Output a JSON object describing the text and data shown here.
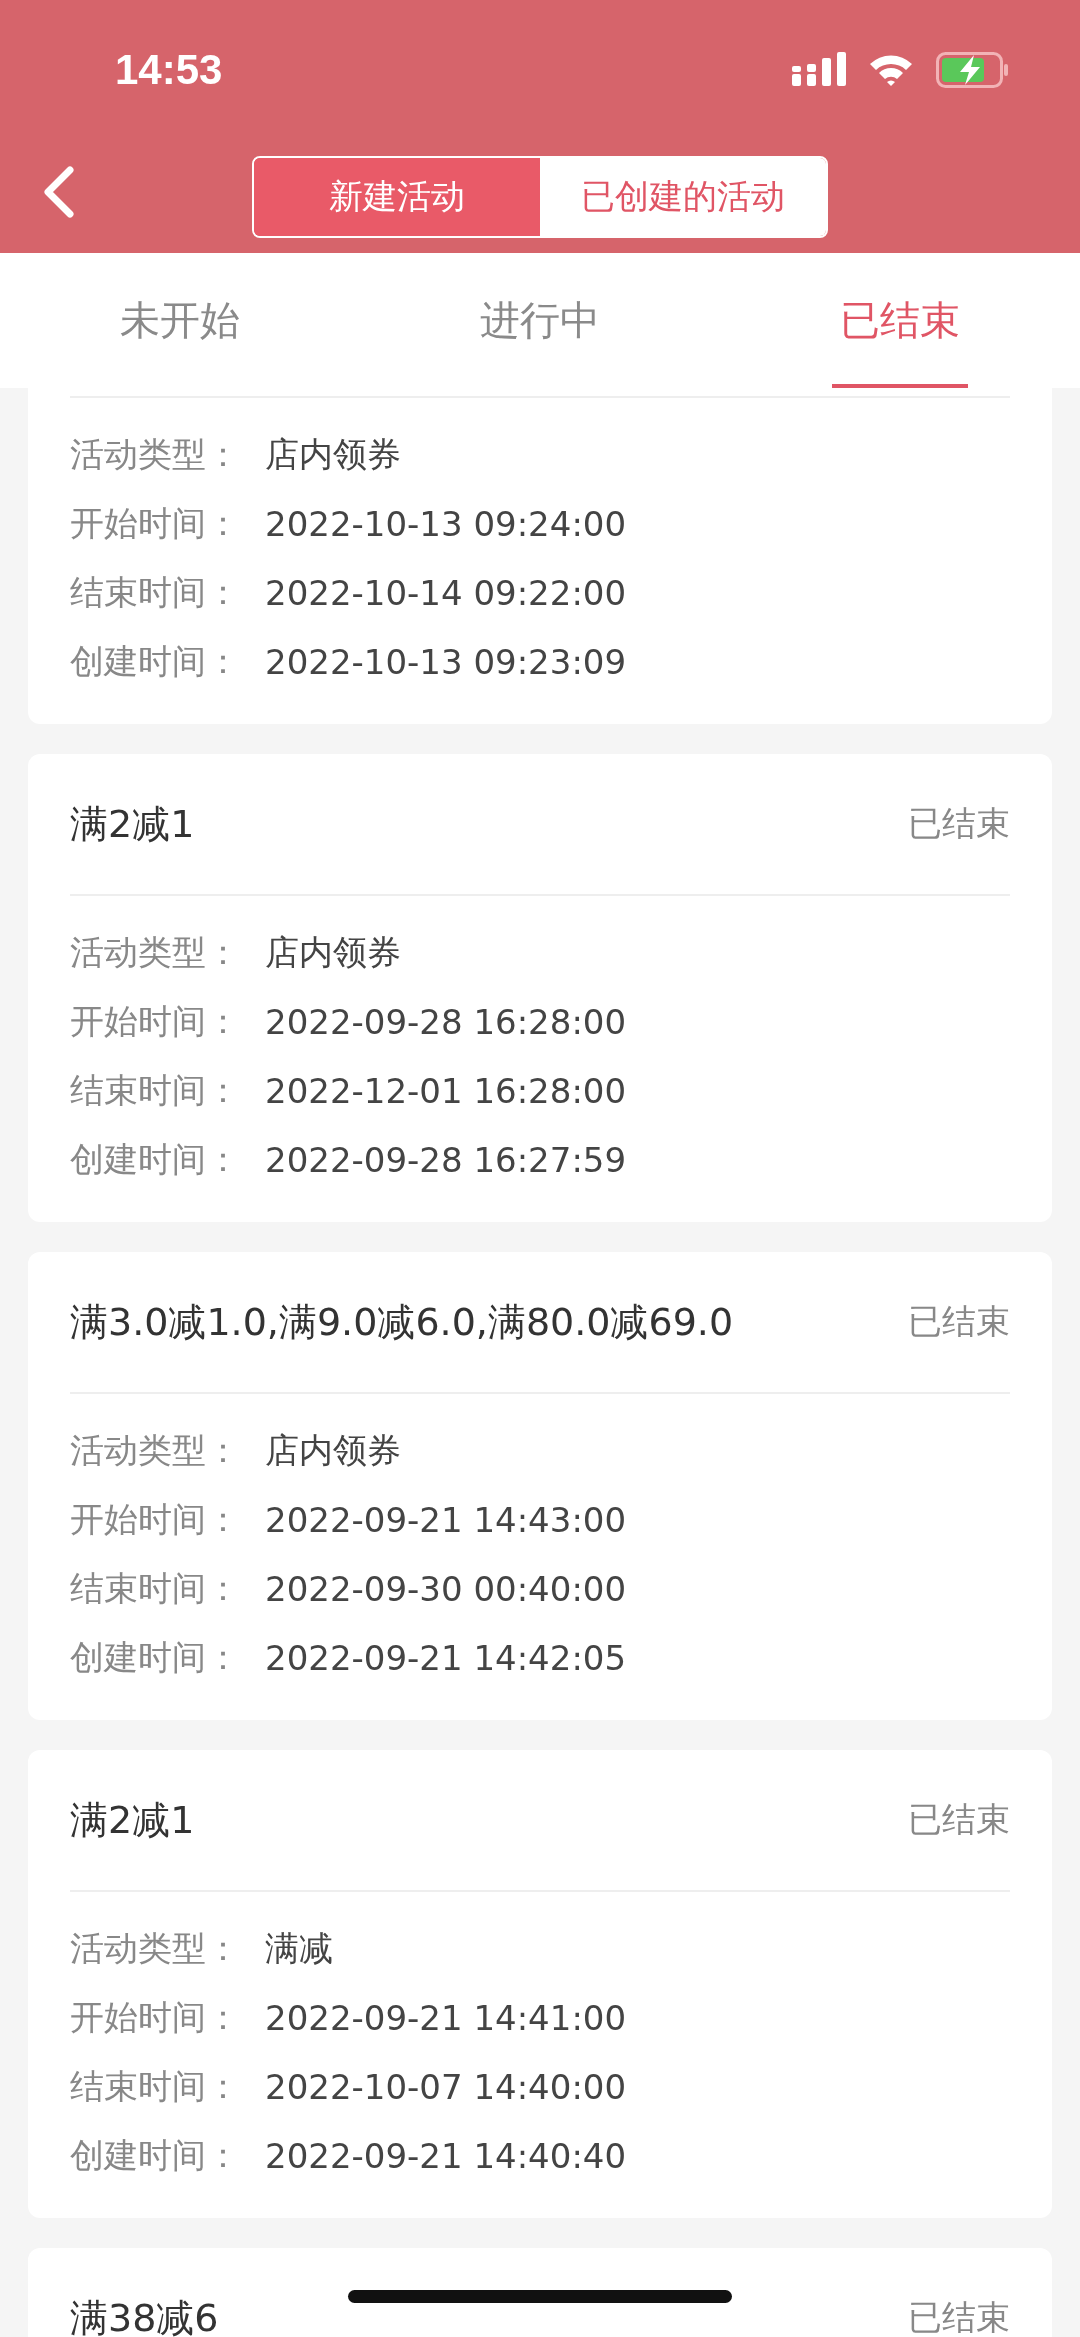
{
  "status_bar": {
    "time": "14:53"
  },
  "segments": [
    {
      "label": "新建活动",
      "selected": false
    },
    {
      "label": "已创建的活动",
      "selected": true
    }
  ],
  "tabs": [
    {
      "label": "未开始",
      "selected": false
    },
    {
      "label": "进行中",
      "selected": false
    },
    {
      "label": "已结束",
      "selected": true
    }
  ],
  "cards": [
    {
      "fields": [
        {
          "label": "活动类型：",
          "value": "店内领券"
        },
        {
          "label": "开始时间：",
          "value": "2022-10-13 09:24:00"
        },
        {
          "label": "结束时间：",
          "value": "2022-10-14 09:22:00"
        },
        {
          "label": "创建时间：",
          "value": "2022-10-13 09:23:09"
        }
      ]
    },
    {
      "title": "满2减1",
      "status": "已结束",
      "fields": [
        {
          "label": "活动类型：",
          "value": "店内领券"
        },
        {
          "label": "开始时间：",
          "value": "2022-09-28 16:28:00"
        },
        {
          "label": "结束时间：",
          "value": "2022-12-01 16:28:00"
        },
        {
          "label": "创建时间：",
          "value": "2022-09-28 16:27:59"
        }
      ]
    },
    {
      "title": "满3.0减1.0,满9.0减6.0,满80.0减69.0",
      "status": "已结束",
      "fields": [
        {
          "label": "活动类型：",
          "value": "店内领券"
        },
        {
          "label": "开始时间：",
          "value": "2022-09-21 14:43:00"
        },
        {
          "label": "结束时间：",
          "value": "2022-09-30 00:40:00"
        },
        {
          "label": "创建时间：",
          "value": "2022-09-21 14:42:05"
        }
      ]
    },
    {
      "title": "满2减1",
      "status": "已结束",
      "fields": [
        {
          "label": "活动类型：",
          "value": "满减"
        },
        {
          "label": "开始时间：",
          "value": "2022-09-21 14:41:00"
        },
        {
          "label": "结束时间：",
          "value": "2022-10-07 14:40:00"
        },
        {
          "label": "创建时间：",
          "value": "2022-09-21 14:40:40"
        }
      ]
    },
    {
      "title": "满38减6",
      "status": "已结束"
    }
  ]
}
